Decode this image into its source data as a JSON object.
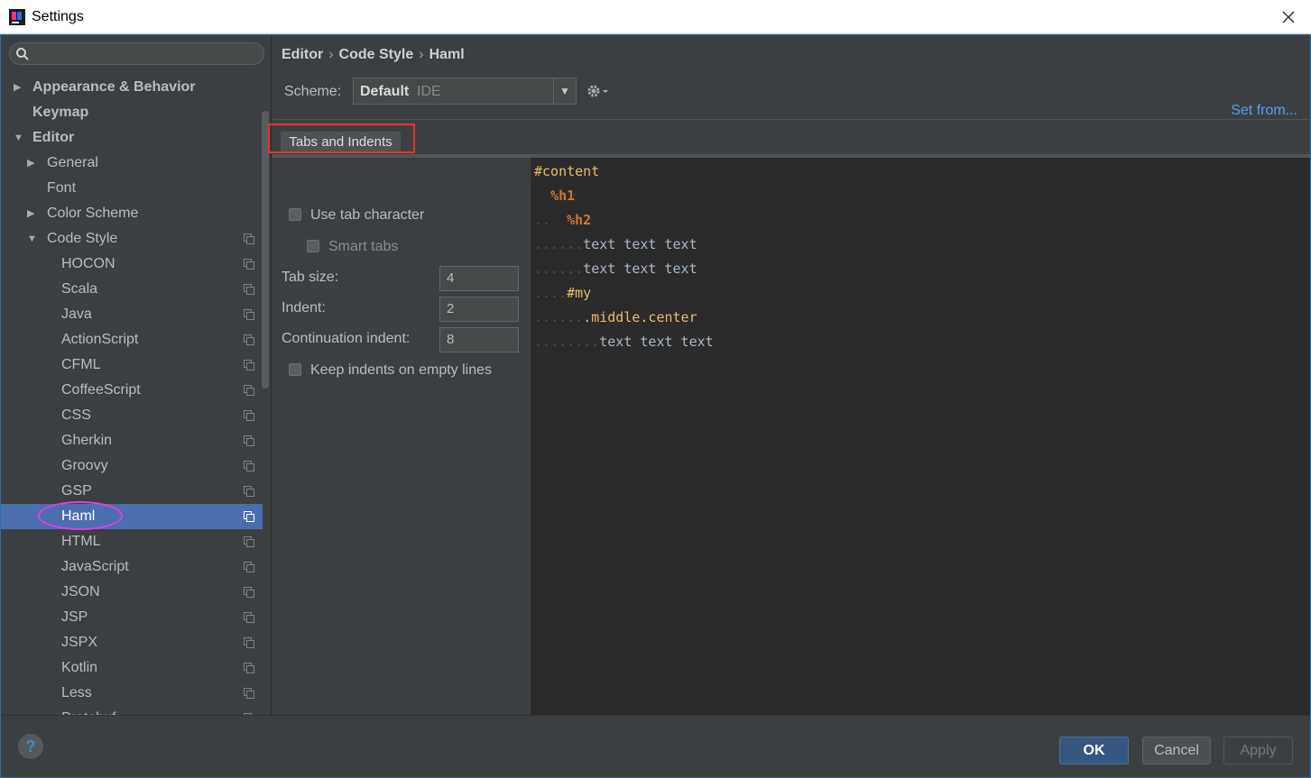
{
  "window": {
    "title": "Settings"
  },
  "search": {
    "placeholder": ""
  },
  "sidebar": {
    "items": [
      {
        "label": "Appearance & Behavior",
        "arrow": "▶",
        "bold": true,
        "indent": 0
      },
      {
        "label": "Keymap",
        "arrow": "",
        "bold": true,
        "indent": 0
      },
      {
        "label": "Editor",
        "arrow": "▼",
        "bold": true,
        "indent": 0
      },
      {
        "label": "General",
        "arrow": "▶",
        "bold": false,
        "indent": 1
      },
      {
        "label": "Font",
        "arrow": "",
        "bold": false,
        "indent": 1
      },
      {
        "label": "Color Scheme",
        "arrow": "▶",
        "bold": false,
        "indent": 1
      },
      {
        "label": "Code Style",
        "arrow": "▼",
        "bold": false,
        "indent": 1,
        "copy": true
      },
      {
        "label": "HOCON",
        "arrow": "",
        "bold": false,
        "indent": 2,
        "copy": true
      },
      {
        "label": "Scala",
        "arrow": "",
        "bold": false,
        "indent": 2,
        "copy": true
      },
      {
        "label": "Java",
        "arrow": "",
        "bold": false,
        "indent": 2,
        "copy": true
      },
      {
        "label": "ActionScript",
        "arrow": "",
        "bold": false,
        "indent": 2,
        "copy": true
      },
      {
        "label": "CFML",
        "arrow": "",
        "bold": false,
        "indent": 2,
        "copy": true
      },
      {
        "label": "CoffeeScript",
        "arrow": "",
        "bold": false,
        "indent": 2,
        "copy": true
      },
      {
        "label": "CSS",
        "arrow": "",
        "bold": false,
        "indent": 2,
        "copy": true
      },
      {
        "label": "Gherkin",
        "arrow": "",
        "bold": false,
        "indent": 2,
        "copy": true
      },
      {
        "label": "Groovy",
        "arrow": "",
        "bold": false,
        "indent": 2,
        "copy": true
      },
      {
        "label": "GSP",
        "arrow": "",
        "bold": false,
        "indent": 2,
        "copy": true
      },
      {
        "label": "Haml",
        "arrow": "",
        "bold": false,
        "indent": 2,
        "copy": true,
        "selected": true
      },
      {
        "label": "HTML",
        "arrow": "",
        "bold": false,
        "indent": 2,
        "copy": true
      },
      {
        "label": "JavaScript",
        "arrow": "",
        "bold": false,
        "indent": 2,
        "copy": true
      },
      {
        "label": "JSON",
        "arrow": "",
        "bold": false,
        "indent": 2,
        "copy": true
      },
      {
        "label": "JSP",
        "arrow": "",
        "bold": false,
        "indent": 2,
        "copy": true
      },
      {
        "label": "JSPX",
        "arrow": "",
        "bold": false,
        "indent": 2,
        "copy": true
      },
      {
        "label": "Kotlin",
        "arrow": "",
        "bold": false,
        "indent": 2,
        "copy": true
      },
      {
        "label": "Less",
        "arrow": "",
        "bold": false,
        "indent": 2,
        "copy": true
      },
      {
        "label": "Protobuf",
        "arrow": "",
        "bold": false,
        "indent": 2,
        "copy": true
      }
    ]
  },
  "breadcrumb": [
    "Editor",
    "Code Style",
    "Haml"
  ],
  "breadcrumb_sep": "›",
  "scheme": {
    "label": "Scheme:",
    "value": "Default",
    "sub": "IDE"
  },
  "set_from": "Set from...",
  "tabs": [
    {
      "label": "Tabs and Indents",
      "active": true
    }
  ],
  "options": {
    "use_tab": "Use tab character",
    "smart_tabs": "Smart tabs",
    "tab_size_label": "Tab size:",
    "tab_size": "4",
    "indent_label": "Indent:",
    "indent": "2",
    "cont_indent_label": "Continuation indent:",
    "cont_indent": "8",
    "keep_indents": "Keep indents on empty lines"
  },
  "code": [
    {
      "dots": "",
      "parts": [
        {
          "t": "#content",
          "c": "c-tag"
        }
      ]
    },
    {
      "dots": "  ",
      "parts": [
        {
          "t": "%h1",
          "c": "c-orange"
        }
      ]
    },
    {
      "dots": "..",
      "pad": "  ",
      "parts": [
        {
          "t": "%h2",
          "c": "c-orange"
        }
      ]
    },
    {
      "dots": "......",
      "parts": [
        {
          "t": "text text text",
          "c": "c-text"
        }
      ]
    },
    {
      "dots": "......",
      "parts": [
        {
          "t": "text text text",
          "c": "c-text"
        }
      ]
    },
    {
      "dots": "....",
      "parts": [
        {
          "t": "#my",
          "c": "c-tag"
        }
      ]
    },
    {
      "dots": "......",
      "parts": [
        {
          "t": ".middle.center",
          "c": "c-tag"
        }
      ]
    },
    {
      "dots": "........",
      "parts": [
        {
          "t": "text text text",
          "c": "c-text"
        }
      ]
    }
  ],
  "buttons": {
    "help": "?",
    "ok": "OK",
    "cancel": "Cancel",
    "apply": "Apply"
  }
}
